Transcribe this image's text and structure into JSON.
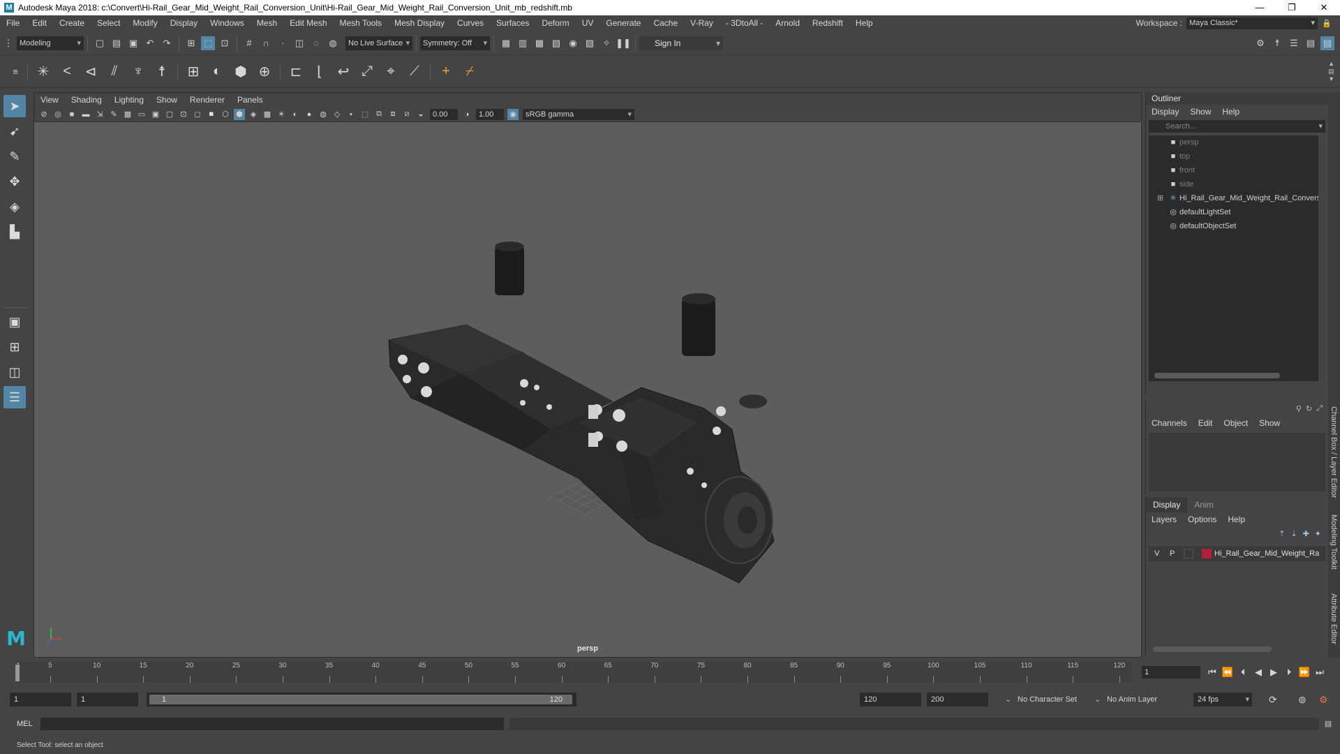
{
  "window": {
    "title": "Autodesk Maya 2018: c:\\Convert\\Hi-Rail_Gear_Mid_Weight_Rail_Conversion_Unit\\Hi-Rail_Gear_Mid_Weight_Rail_Conversion_Unit_mb_redshift.mb",
    "logo_letter": "M",
    "minimize": "—",
    "restore": "❐",
    "close": "✕"
  },
  "menubar": {
    "items": [
      "File",
      "Edit",
      "Create",
      "Select",
      "Modify",
      "Display",
      "Windows",
      "Mesh",
      "Edit Mesh",
      "Mesh Tools",
      "Mesh Display",
      "Curves",
      "Surfaces",
      "Deform",
      "UV",
      "Generate",
      "Cache",
      "V-Ray",
      "- 3DtoAll -",
      "Arnold",
      "Redshift",
      "Help"
    ],
    "workspace_label": "Workspace :",
    "workspace_value": "Maya Classic*"
  },
  "statusline": {
    "mode": "Modeling",
    "live_surface": "No Live Surface",
    "symmetry": "Symmetry: Off",
    "sign_in": "Sign In"
  },
  "viewport": {
    "menus": [
      "View",
      "Shading",
      "Lighting",
      "Show",
      "Renderer",
      "Panels"
    ],
    "exposure": "0.00",
    "gamma": "1.00",
    "color_space": "sRGB gamma",
    "camera": "persp"
  },
  "outliner": {
    "title": "Outliner",
    "menus": [
      "Display",
      "Show",
      "Help"
    ],
    "search_placeholder": "Search...",
    "items": [
      {
        "label": "persp",
        "icon": "camera-icon",
        "dim": true
      },
      {
        "label": "top",
        "icon": "camera-icon",
        "dim": true
      },
      {
        "label": "front",
        "icon": "camera-icon",
        "dim": true
      },
      {
        "label": "side",
        "icon": "camera-icon",
        "dim": true
      },
      {
        "label": "Hi_Rail_Gear_Mid_Weight_Rail_Conversi",
        "icon": "transform-icon",
        "dim": false
      },
      {
        "label": "defaultLightSet",
        "icon": "set-icon",
        "dim": false
      },
      {
        "label": "defaultObjectSet",
        "icon": "set-icon",
        "dim": false
      }
    ]
  },
  "channelbox": {
    "menus": [
      "Channels",
      "Edit",
      "Object",
      "Show"
    ]
  },
  "layer_editor": {
    "tabs": [
      "Display",
      "Anim"
    ],
    "menus": [
      "Layers",
      "Options",
      "Help"
    ],
    "layer": {
      "v": "V",
      "p": "P",
      "name": "Hi_Rail_Gear_Mid_Weight_Rail",
      "color": "#b0203a"
    }
  },
  "side_tabs": [
    "Channel Box / Layer Editor",
    "Modeling Toolkit",
    "Attribute Editor"
  ],
  "timeline": {
    "ticks": [
      "5",
      "10",
      "15",
      "20",
      "25",
      "30",
      "35",
      "40",
      "45",
      "50",
      "55",
      "60",
      "65",
      "70",
      "75",
      "80",
      "85",
      "90",
      "95",
      "100",
      "105",
      "110",
      "115",
      "120"
    ],
    "first_label": "1",
    "current_frame": "1"
  },
  "range": {
    "start": "1",
    "playback_start": "1",
    "range_start": "1",
    "range_end": "120",
    "playback_end": "120",
    "end": "200",
    "character_set": "No Character Set",
    "anim_layer": "No Anim Layer",
    "fps": "24 fps"
  },
  "cmdline": {
    "label": "MEL"
  },
  "helpline": {
    "text": "Select Tool: select an object"
  },
  "colors": {
    "accent": "#5285a6",
    "layer_red": "#b0203a",
    "maya_logo": "#2fb6cf"
  }
}
